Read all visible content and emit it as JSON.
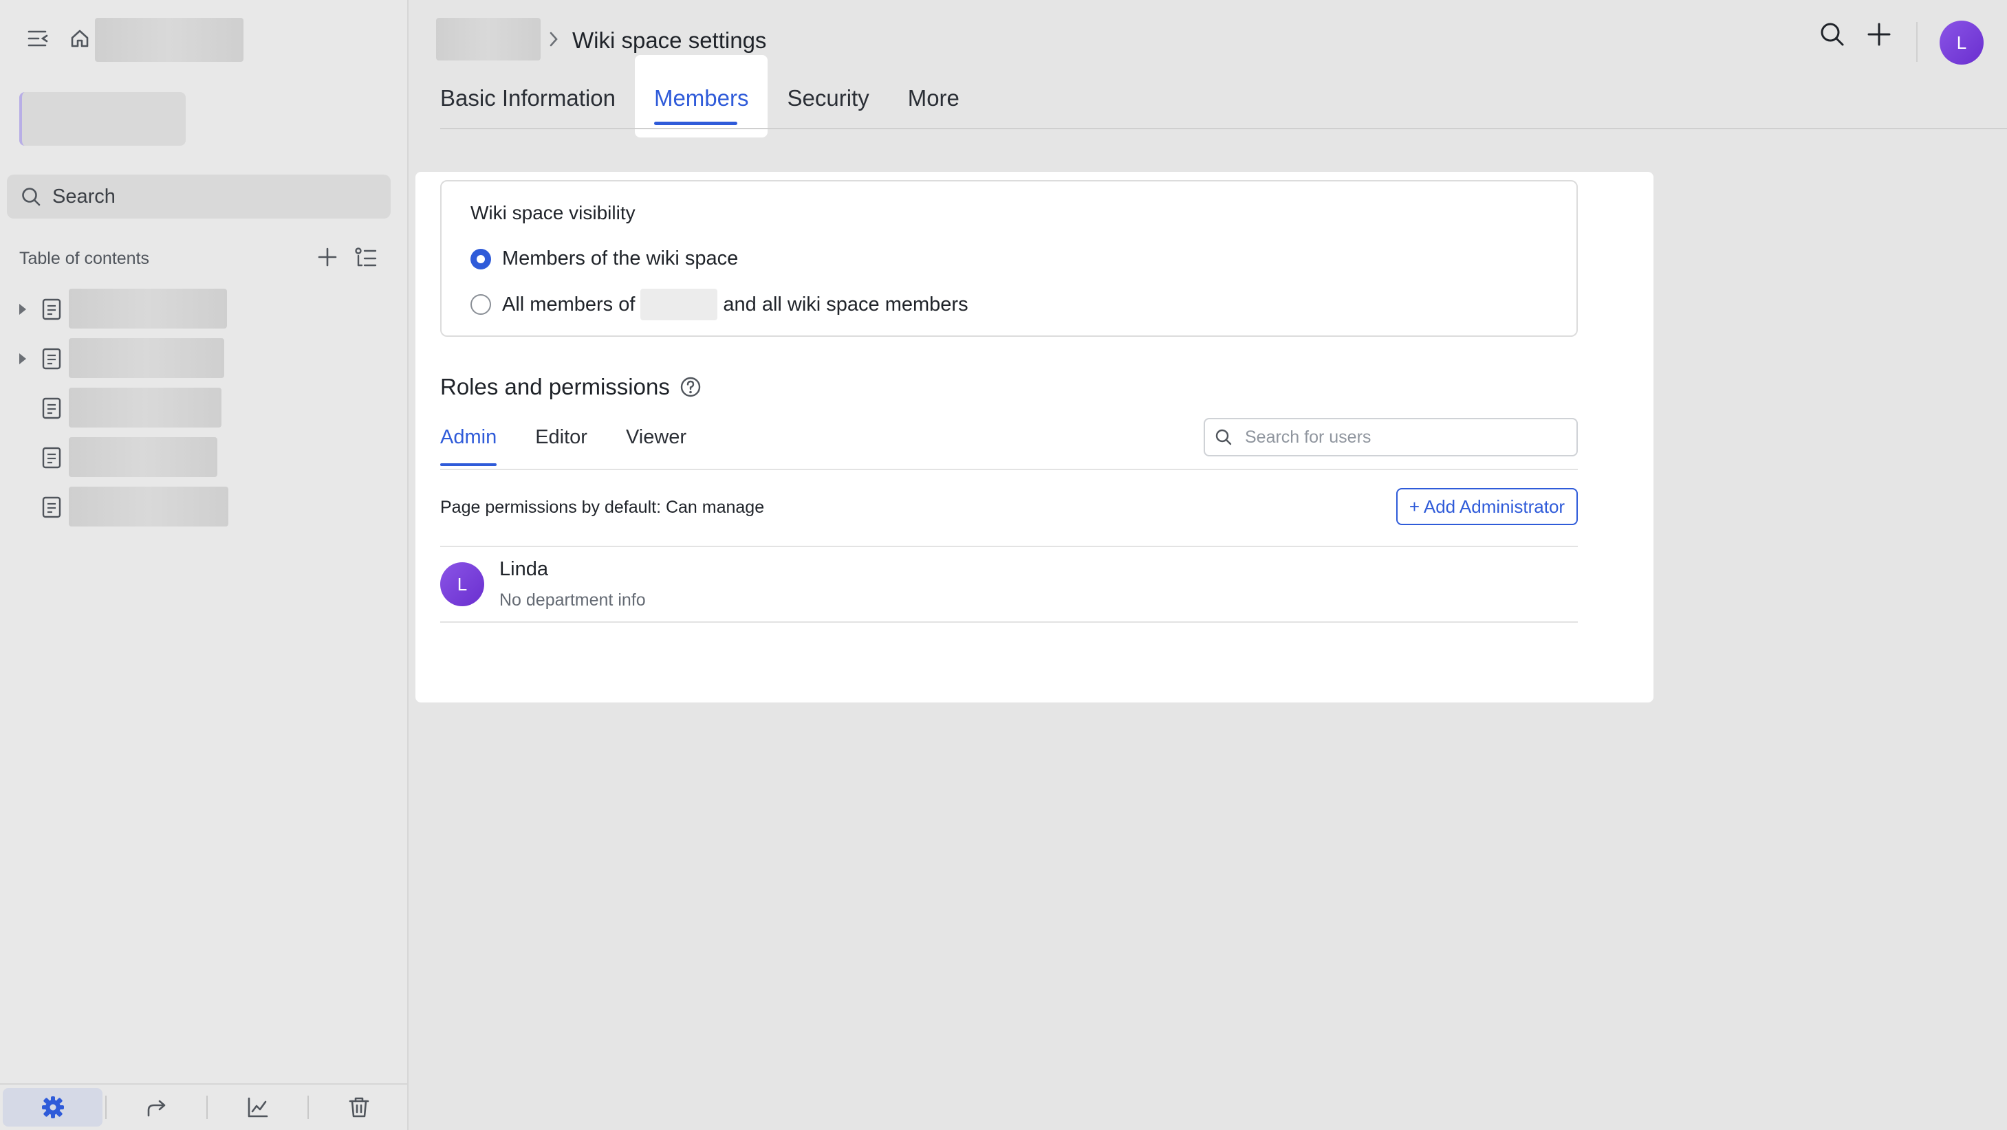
{
  "header": {
    "breadcrumb_sep": "›",
    "title": "Wiki space settings",
    "avatar_initial": "L"
  },
  "sidebar": {
    "search_label": "Search",
    "toc_title": "Table of contents",
    "toc_items": [
      {
        "has_children": true
      },
      {
        "has_children": true
      },
      {
        "has_children": false
      },
      {
        "has_children": false
      },
      {
        "has_children": false
      }
    ],
    "bottom_actions": [
      "settings",
      "share",
      "analytics",
      "trash"
    ]
  },
  "tabs": [
    "Basic Information",
    "Members",
    "Security",
    "More"
  ],
  "active_tab": "Members",
  "visibility": {
    "title": "Wiki space visibility",
    "option1": "Members of the wiki space",
    "option2_prefix": "All members of",
    "option2_suffix": "and all wiki space members",
    "selected": 0
  },
  "roles": {
    "title": "Roles and permissions",
    "tabs": [
      "Admin",
      "Editor",
      "Viewer"
    ],
    "active": "Admin",
    "search_placeholder": "Search for users",
    "default_perm": "Page permissions by default: Can manage",
    "add_button": "+ Add Administrator"
  },
  "members": [
    {
      "initial": "L",
      "name": "Linda",
      "dept": "No department info"
    }
  ],
  "colors": {
    "accent": "#2f5bd9",
    "avatar": "#7b3fe0",
    "background": "#e5e5e5",
    "card": "#ffffff"
  }
}
